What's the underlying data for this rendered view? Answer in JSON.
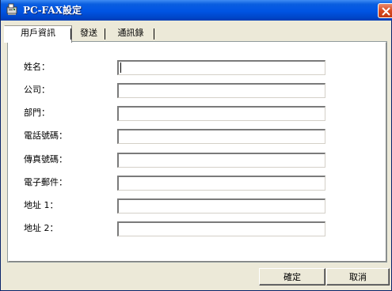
{
  "window": {
    "title": "PC-FAX設定"
  },
  "tabs": [
    {
      "label": "用戶資訊",
      "active": true
    },
    {
      "label": "發送",
      "active": false
    },
    {
      "label": "通訊錄",
      "active": false
    }
  ],
  "form": {
    "fields": [
      {
        "label": "姓名：",
        "value": ""
      },
      {
        "label": "公司：",
        "value": ""
      },
      {
        "label": "部門：",
        "value": ""
      },
      {
        "label": "電話號碼：",
        "value": ""
      },
      {
        "label": "傳真號碼：",
        "value": ""
      },
      {
        "label": "電子郵件：",
        "value": ""
      },
      {
        "label": "地址 1：",
        "value": ""
      },
      {
        "label": "地址 2：",
        "value": ""
      }
    ]
  },
  "buttons": {
    "ok_label": "確定",
    "cancel_label": "取消"
  },
  "colors": {
    "titlebar": "#0054e3",
    "window_bg": "#ece9d8",
    "close_button": "#d94a22"
  },
  "icons": {
    "title_icon": "fax-icon",
    "close_icon": "close-icon"
  }
}
